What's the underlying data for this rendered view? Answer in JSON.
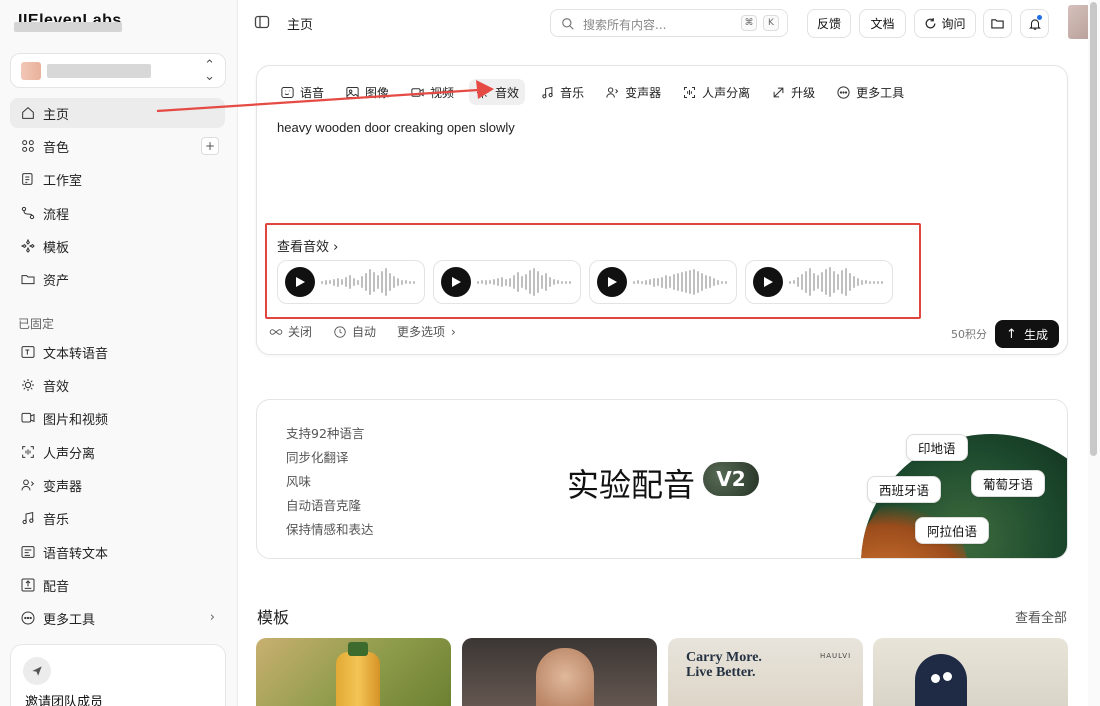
{
  "app": {
    "logo": "IIElevenLabs"
  },
  "sidebar": {
    "items": [
      {
        "label": "主页",
        "icon": "home-icon"
      },
      {
        "label": "音色",
        "icon": "voices-icon"
      },
      {
        "label": "工作室",
        "icon": "studio-icon"
      },
      {
        "label": "流程",
        "icon": "flows-icon"
      },
      {
        "label": "模板",
        "icon": "templates-icon"
      },
      {
        "label": "资产",
        "icon": "assets-icon"
      }
    ],
    "pinned_heading": "已固定",
    "pinned": [
      {
        "label": "文本转语音",
        "icon": "text-to-speech-icon"
      },
      {
        "label": "音效",
        "icon": "sound-effects-icon"
      },
      {
        "label": "图片和视频",
        "icon": "image-video-icon"
      },
      {
        "label": "人声分离",
        "icon": "voice-isolator-icon"
      },
      {
        "label": "变声器",
        "icon": "voice-changer-icon"
      },
      {
        "label": "音乐",
        "icon": "music-icon"
      },
      {
        "label": "语音转文本",
        "icon": "speech-to-text-icon"
      },
      {
        "label": "配音",
        "icon": "dubbing-icon"
      },
      {
        "label": "更多工具",
        "icon": "more-tools-icon"
      }
    ],
    "invite_label": "邀请团队成员"
  },
  "topbar": {
    "breadcrumb": "主页",
    "search_placeholder": "搜索所有内容...",
    "shortcut": [
      "⌘",
      "K"
    ],
    "feedback": "反馈",
    "docs": "文档",
    "ask": "询问"
  },
  "composer": {
    "tabs": [
      {
        "label": "语音",
        "icon": "speech-icon"
      },
      {
        "label": "图像",
        "icon": "image-icon"
      },
      {
        "label": "视频",
        "icon": "video-icon"
      },
      {
        "label": "音效",
        "icon": "sound-effect-icon",
        "active": true
      },
      {
        "label": "音乐",
        "icon": "music-note-icon"
      },
      {
        "label": "变声器",
        "icon": "voice-changer-tab-icon"
      },
      {
        "label": "人声分离",
        "icon": "isolator-tab-icon"
      },
      {
        "label": "升级",
        "icon": "upscale-icon"
      },
      {
        "label": "更多工具",
        "icon": "more-icon"
      }
    ],
    "prompt": "heavy wooden door creaking open slowly",
    "view_effects": "查看音效",
    "bottom": {
      "loop": "关闭",
      "duration": "自动",
      "more_options": "更多选项",
      "credits": "50积分",
      "generate": "生成"
    }
  },
  "banner": {
    "features": [
      "支持92种语言",
      "同步化翻译",
      "风味",
      "自动语音克隆",
      "保持情感和表达"
    ],
    "title": "实验配音",
    "badge": "V2",
    "languages": [
      "印地语",
      "西班牙语",
      "葡萄牙语",
      "阿拉伯语"
    ]
  },
  "templates": {
    "heading": "模板",
    "see_all": "查看全部",
    "card3_title": "Carry More. Live Better.",
    "card3_brand": "HAULVI"
  },
  "colors": {
    "accent": "#111111",
    "highlight_box": "#e0453f",
    "arrow": "#e64a45"
  }
}
